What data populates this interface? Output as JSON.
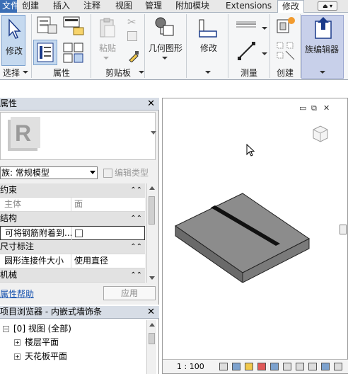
{
  "ribbon": {
    "tabs": [
      "文件",
      "创建",
      "插入",
      "注释",
      "视图",
      "管理",
      "附加模块",
      "Extensions",
      "修改"
    ],
    "active_tab": "修改",
    "tab_dropdown": "⏏ ▾",
    "buttons": {
      "modify": "修改",
      "paste": "粘贴",
      "geometry": "几何图形",
      "modify2": "修改",
      "family_editor": "族编辑器"
    },
    "panels": {
      "select": "选择",
      "properties": "属性",
      "clipboard": "剪贴板",
      "measure": "测量",
      "create": "创建"
    }
  },
  "properties": {
    "title": "属性",
    "close": "✕",
    "type_selector": "族: 常规模型",
    "edit_type": "编辑类型",
    "rows": [
      {
        "kind": "cat",
        "key": "约束",
        "collapse": "⌃"
      },
      {
        "kind": "dim",
        "key": "主体",
        "value": "面"
      },
      {
        "kind": "cat",
        "key": "结构",
        "collapse": "⌃"
      },
      {
        "kind": "check",
        "key": "可将钢筋附着到...",
        "value": ""
      },
      {
        "kind": "cat",
        "key": "尺寸标注",
        "collapse": "⌃"
      },
      {
        "kind": "row",
        "key": "圆形连接件大小",
        "value": "使用直径"
      },
      {
        "kind": "cat",
        "key": "机械",
        "collapse": "⌃"
      }
    ],
    "help_link": "属性帮助",
    "apply": "应用"
  },
  "browser": {
    "title": "项目浏览器 - 内嵌式墙饰条",
    "close": "✕",
    "items": [
      {
        "label": "[0] 视图 (全部)",
        "expander": "−"
      },
      {
        "label": "楼层平面",
        "expander": "+"
      },
      {
        "label": "天花板平面",
        "expander": "+"
      }
    ]
  },
  "view": {
    "window_controls": [
      "▭",
      "⧉",
      "✕"
    ],
    "scale": "1 : 100"
  },
  "colors": {
    "active_tab": "#ffffff",
    "file_tab": "#3b6fb6",
    "selected_button": "#c5d9ef",
    "slab_top": "#8c8c8c",
    "slab_front": "#6a6a6a",
    "slab_side": "#7a7a7a",
    "groove": "#111111"
  }
}
